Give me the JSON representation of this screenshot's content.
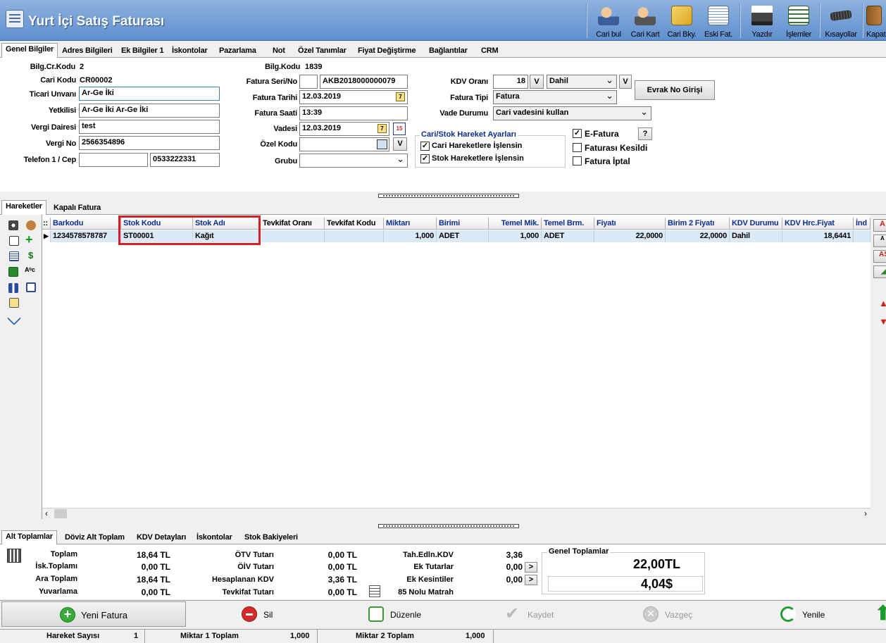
{
  "app": {
    "title": "Yurt İçi Satış Faturası"
  },
  "toolbar": [
    {
      "label": "Cari bul",
      "icon": "person-search-icon"
    },
    {
      "label": "Cari Kart",
      "icon": "person-card-icon"
    },
    {
      "label": "Cari Bky.",
      "icon": "balance-report-icon"
    },
    {
      "label": "Eski Fat.",
      "icon": "old-invoices-icon"
    },
    {
      "label": "Yazdır",
      "icon": "printer-icon"
    },
    {
      "label": "İşlemler",
      "icon": "operations-icon"
    },
    {
      "label": "Kısayollar",
      "icon": "keyboard-icon"
    },
    {
      "label": "Kapat",
      "icon": "exit-door-icon"
    }
  ],
  "tabs": [
    "Genel Bilgiler",
    "Adres Bilgileri",
    "Ek Bilgiler 1",
    "İskontolar",
    "Pazarlama",
    "Not",
    "Özel Tanımlar",
    "Fiyat Değiştirme",
    "Bağlantılar",
    "CRM"
  ],
  "form": {
    "bilg_cr_kodu_label": "Bilg.Cr.Kodu",
    "bilg_cr_kodu": "2",
    "cari_kodu_label": "Cari Kodu",
    "cari_kodu": "CR00002",
    "ticari_unvani_label": "Ticari Unvanı",
    "ticari_unvani": "Ar-Ge İki",
    "yetkilisi_label": "Yetkilisi",
    "yetkilisi": "Ar-Ge İki Ar-Ge İki",
    "vergi_dairesi_label": "Vergi Dairesi",
    "vergi_dairesi": "test",
    "vergi_no_label": "Vergi No",
    "vergi_no": "2566354896",
    "telefon_label": "Telefon 1 / Cep",
    "telefon": "",
    "cep": "0533222331",
    "bilg_kodu_label": "Bilg.Kodu",
    "bilg_kodu": "1839",
    "fatura_seri_label": "Fatura Seri/No",
    "fatura_seri": "",
    "fatura_no": "AKB2018000000079",
    "fatura_tarihi_label": "Fatura Tarihi",
    "fatura_tarihi": "12.03.2019",
    "fatura_saati_label": "Fatura Saati",
    "fatura_saati": "13:39",
    "vadesi_label": "Vadesi",
    "vadesi": "12.03.2019",
    "ozel_kodu_label": "Özel Kodu",
    "ozel_kodu": "",
    "grubu_label": "Grubu",
    "grubu": "",
    "kdv_orani_label": "KDV Oranı",
    "kdv_orani": "18",
    "kdv_tipi": "Dahil",
    "v_label": "V",
    "fatura_tipi_label": "Fatura Tipi",
    "fatura_tipi": "Fatura",
    "vade_durumu_label": "Vade Durumu",
    "vade_durumu": "Cari vadesini kullan",
    "evrak_button": "Evrak No Girişi",
    "group_title": "Cari/Stok Hareket Ayarları",
    "cari_hareket": "Cari Hareketlere İşlensin",
    "stok_hareket": "Stok Hareketlere İşlensin",
    "efatura": "E-Fatura",
    "help": "?",
    "faturasi_kesildi": "Faturası Kesildi",
    "fatura_iptal": "Fatura İptal"
  },
  "grid_tabs": [
    "Hareketler",
    "Kapalı Fatura"
  ],
  "grid": {
    "row_marker": "::",
    "columns": [
      "Barkodu",
      "Stok Kodu",
      "Stok Adı",
      "Tevkifat Oranı",
      "Tevkifat Kodu",
      "Miktarı",
      "Birimi",
      "Temel Mik.",
      "Temel Brm.",
      "Fiyatı",
      "Birim 2 Fiyatı",
      "KDV Durumu",
      "KDV Hrc.Fiyat",
      "İnd"
    ],
    "rows": [
      [
        "1234578578787",
        "ST00001",
        "Kağıt",
        "",
        "",
        "1,000",
        "ADET",
        "1,000",
        "ADET",
        "22,0000",
        "22,0000",
        "Dahil",
        "18,6441",
        ""
      ]
    ]
  },
  "summary_tabs": [
    "Alt Toplamlar",
    "Döviz Alt Toplam",
    "KDV Detayları",
    "İskontolar",
    "Stok Bakiyeleri"
  ],
  "summary": {
    "col1": [
      {
        "label": "Toplam",
        "value": "18,64 TL"
      },
      {
        "label": "İsk.Toplamı",
        "value": "0,00 TL"
      },
      {
        "label": "Ara Toplam",
        "value": "18,64 TL"
      },
      {
        "label": "Yuvarlama",
        "value": "0,00 TL"
      }
    ],
    "col2": [
      {
        "label": "ÖTV Tutarı",
        "value": "0,00 TL"
      },
      {
        "label": "ÖİV Tutarı",
        "value": "0,00 TL"
      },
      {
        "label": "Hesaplanan KDV",
        "value": "3,36 TL"
      },
      {
        "label": "Tevkifat Tutarı",
        "value": "0,00 TL"
      }
    ],
    "col3": [
      {
        "label": "Tah.Edln.KDV",
        "value": "3,36"
      },
      {
        "label": "Ek Tutarlar",
        "value": "0,00"
      },
      {
        "label": "Ek Kesintiler",
        "value": "0,00"
      },
      {
        "label": "85 Nolu Matrah",
        "value": ""
      }
    ],
    "ek_button": ">",
    "genel_title": "Genel Toplamlar",
    "genel_tl": "22,00TL",
    "genel_usd": "4,04$"
  },
  "actions": [
    {
      "label": "Yeni Fatura",
      "icon": "plus-circle-icon",
      "enabled": true
    },
    {
      "label": "Sil",
      "icon": "delete-circle-icon",
      "enabled": true
    },
    {
      "label": "Düzenle",
      "icon": "edit-icon",
      "enabled": true
    },
    {
      "label": "Kaydet",
      "icon": "checkmark-icon",
      "enabled": false
    },
    {
      "label": "Vazgeç",
      "icon": "cancel-icon",
      "enabled": false
    },
    {
      "label": "Yenile",
      "icon": "refresh-icon",
      "enabled": true
    }
  ],
  "status": {
    "hareket_label": "Hareket Sayısı",
    "hareket": "1",
    "miktar1_label": "Miktar 1 Toplam",
    "miktar1": "1,000",
    "miktar2_label": "Miktar 2 Toplam",
    "miktar2": "1,000"
  },
  "colors": {
    "accent": "#5f8fcf",
    "header_text": "#0b2f8f",
    "highlight": "#d42027",
    "row_bg": "#dceaf8"
  }
}
